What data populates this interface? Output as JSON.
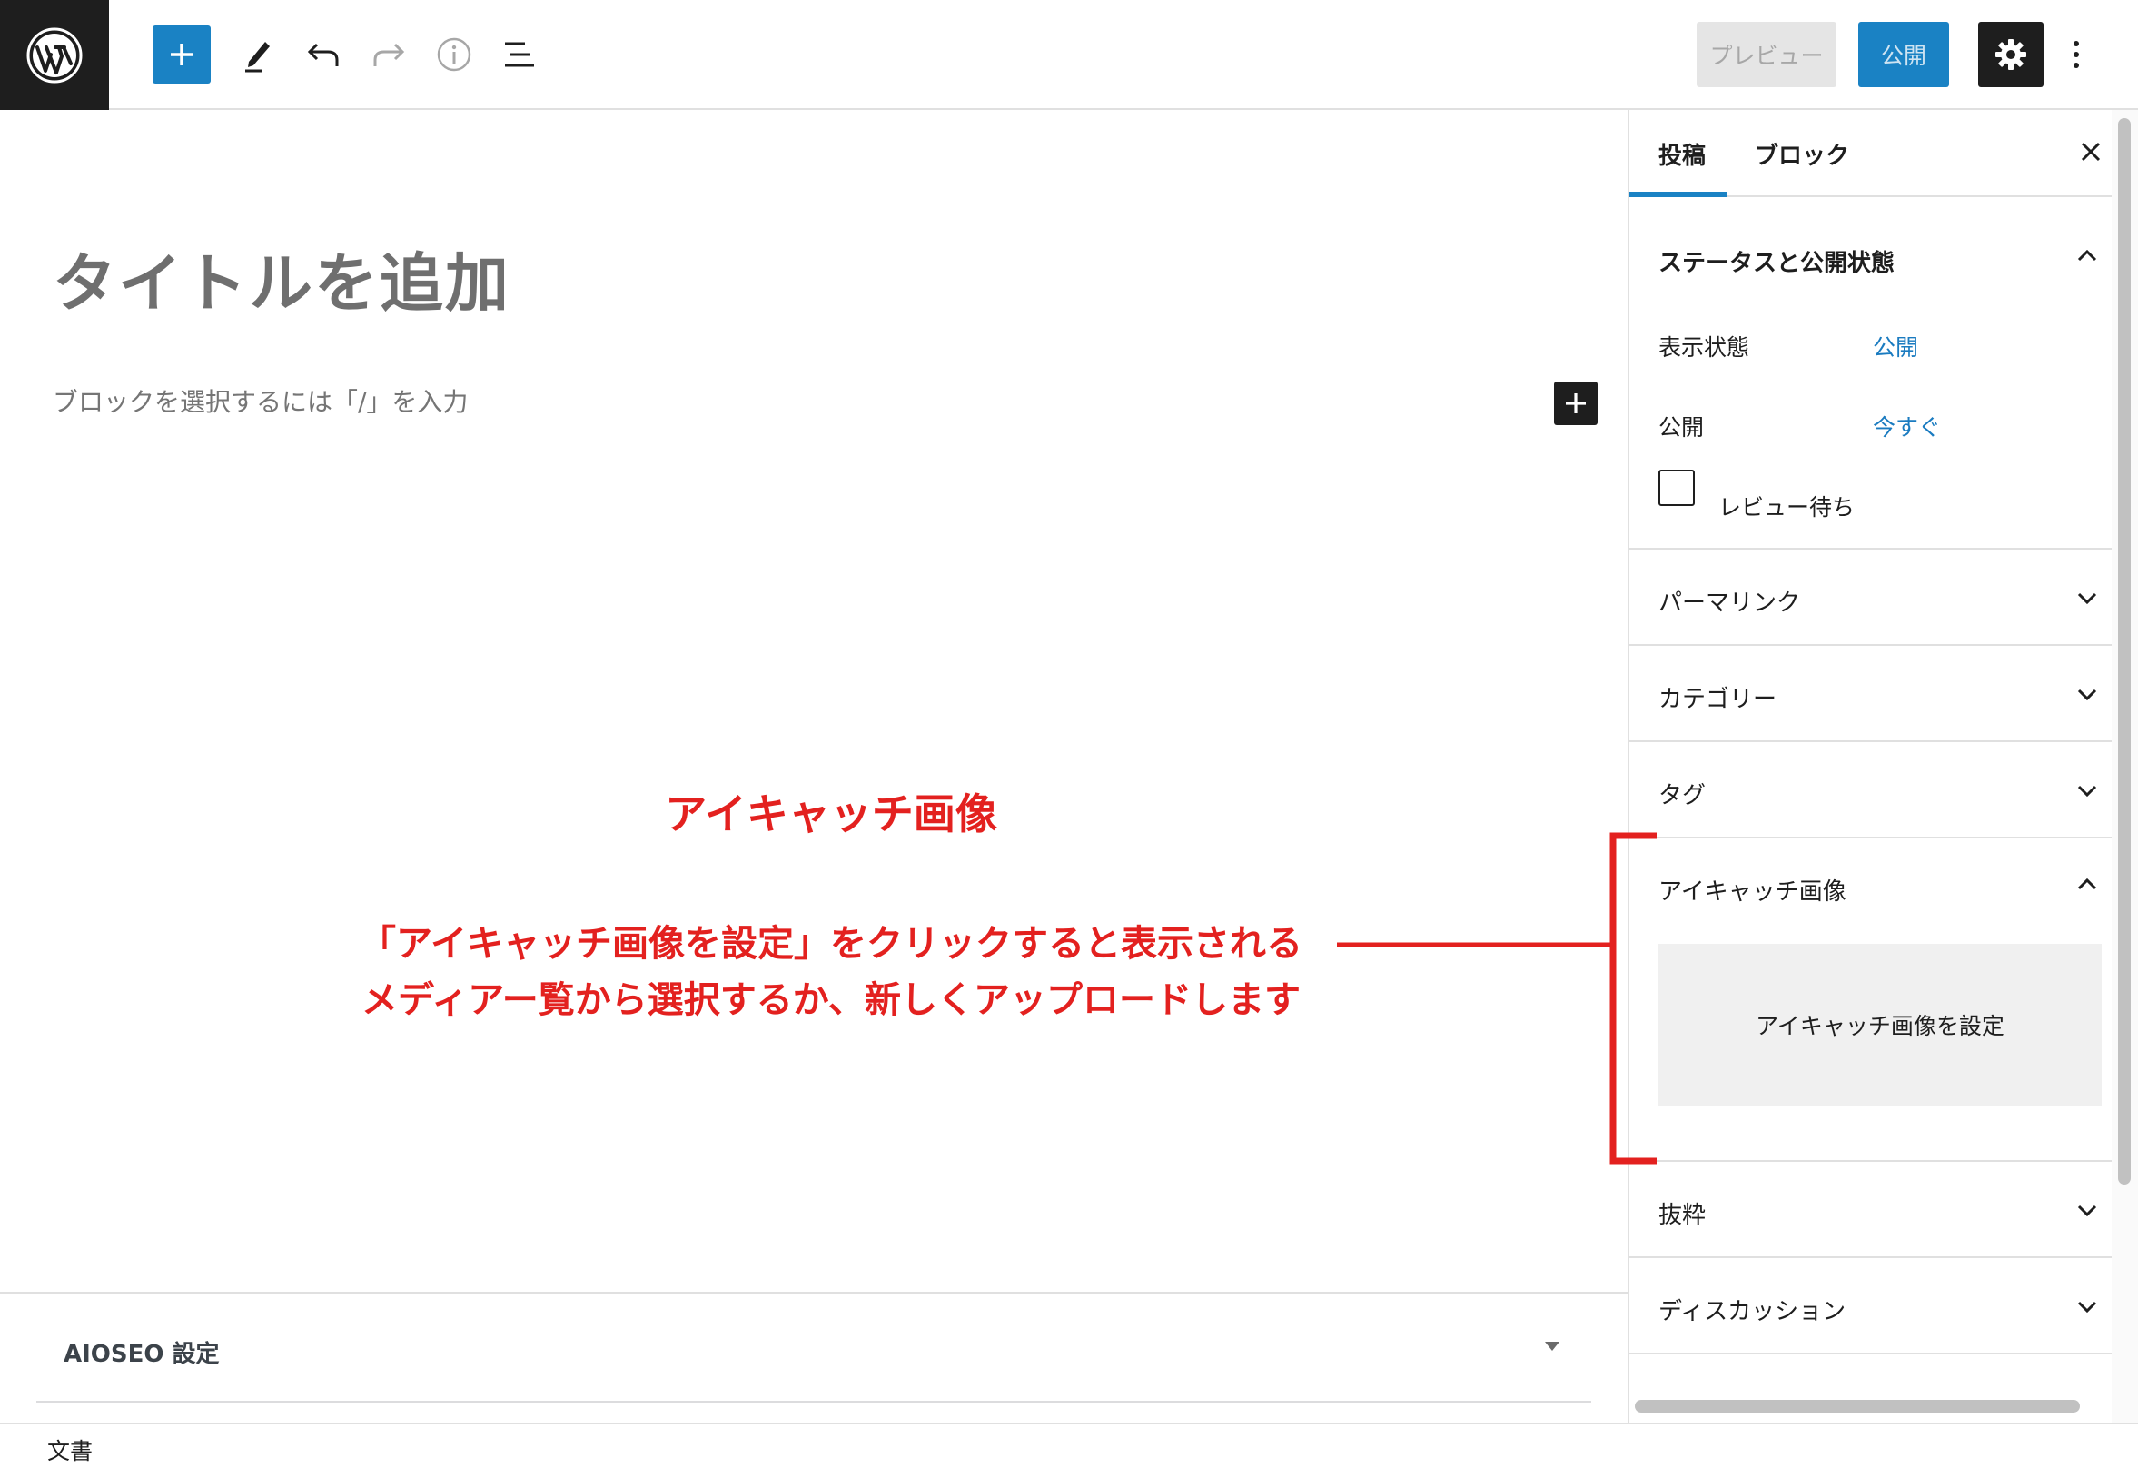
{
  "toolbar": {
    "preview_label": "プレビュー",
    "publish_label": "公開",
    "icons": [
      "wordpress-logo",
      "plus-icon",
      "pencil-icon",
      "undo-icon",
      "redo-icon",
      "info-icon",
      "list-view-icon",
      "gear-icon",
      "more-vertical-icon"
    ],
    "accent_color": "#1a82c4"
  },
  "editor": {
    "title_placeholder": "タイトルを追加",
    "block_hint": "ブロックを選択するには「/」を入力"
  },
  "annotation": {
    "title": "アイキャッチ画像",
    "line1": "「アイキャッチ画像を設定」をクリックすると表示される",
    "line2": "メディアー覧から選択するか、新しくアップロードします",
    "color": "#e3211f"
  },
  "aioseo": {
    "label": "AIOSEO 設定"
  },
  "statusbar": {
    "label": "文書"
  },
  "sidebar": {
    "tabs": [
      {
        "label": "投稿",
        "active": true
      },
      {
        "label": "ブロック",
        "active": false
      }
    ],
    "status_panel": {
      "title": "ステータスと公開状態",
      "visibility_label": "表示状態",
      "visibility_value": "公開",
      "publish_label": "公開",
      "publish_value": "今すぐ",
      "pending_review_label": "レビュー待ち"
    },
    "permalink_title": "パーマリンク",
    "category_title": "カテゴリー",
    "tag_title": "タグ",
    "featured_panel": {
      "title": "アイキャッチ画像",
      "button_label": "アイキャッチ画像を設定"
    },
    "excerpt_title": "抜粋",
    "discussion_title": "ディスカッション"
  }
}
